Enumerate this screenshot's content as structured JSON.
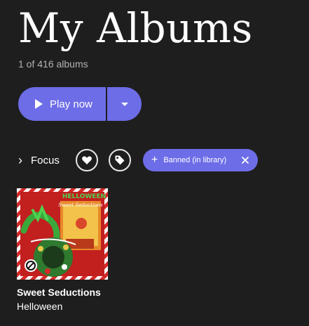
{
  "page": {
    "title": "My Albums",
    "count_text": "1 of 416 albums"
  },
  "playback": {
    "play_label": "Play now",
    "play_icon": "play-icon",
    "more_icon": "chevron-down-icon"
  },
  "filters": {
    "focus_label": "Focus",
    "focus_icon": "chevron-right-icon",
    "favorite_icon": "heart-icon",
    "tag_icon": "tag-icon",
    "active_chip": {
      "label": "Banned (in library)",
      "add_icon": "plus-icon",
      "remove_icon": "close-icon"
    }
  },
  "albums": [
    {
      "title": "Sweet Seductions",
      "artist": "Helloween",
      "cover_text": "HELLOWEEN",
      "cover_script": "Sweet Seductions",
      "badge_icon": "banned-icon"
    }
  ],
  "colors": {
    "background": "#1e1e1e",
    "accent": "#6d6de8",
    "muted_text": "#b3b3b3"
  }
}
